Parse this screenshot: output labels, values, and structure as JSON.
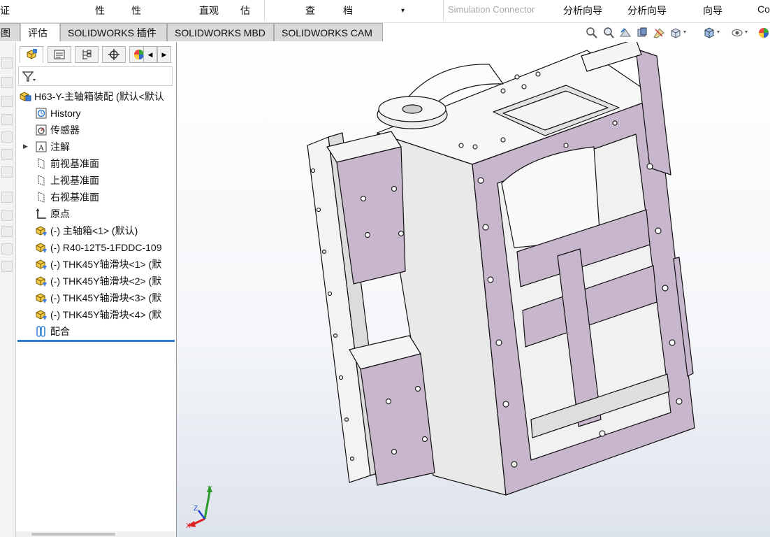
{
  "ribbon": {
    "commands": [
      "证",
      "性",
      "性",
      "直观",
      "估",
      "查",
      "档",
      "▾",
      "Simulation Connector",
      "分析向导",
      "分析向导",
      "向导",
      "Co"
    ]
  },
  "tabs": [
    {
      "label": "图"
    },
    {
      "label": "评估"
    },
    {
      "label": "SOLIDWORKS 插件"
    },
    {
      "label": "SOLIDWORKS MBD"
    },
    {
      "label": "SOLIDWORKS CAM"
    }
  ],
  "feature_tree": {
    "root": "H63-Y-主轴箱装配  (默认<默认",
    "items": [
      {
        "label": "History",
        "icon": "history-icon"
      },
      {
        "label": "传感器",
        "icon": "sensor-icon"
      },
      {
        "label": "注解",
        "icon": "annotation-icon"
      },
      {
        "label": "前视基准面",
        "icon": "plane-icon"
      },
      {
        "label": "上视基准面",
        "icon": "plane-icon"
      },
      {
        "label": "右视基准面",
        "icon": "plane-icon"
      },
      {
        "label": "原点",
        "icon": "origin-icon"
      },
      {
        "label": "(-) 主轴箱<1> (默认)",
        "icon": "part-icon"
      },
      {
        "label": "(-) R40-12T5-1FDDC-109",
        "icon": "part-icon"
      },
      {
        "label": "(-) THK45Y轴滑块<1> (默",
        "icon": "part-icon"
      },
      {
        "label": "(-) THK45Y轴滑块<2> (默",
        "icon": "part-icon"
      },
      {
        "label": "(-) THK45Y轴滑块<3> (默",
        "icon": "part-icon"
      },
      {
        "label": "(-) THK45Y轴滑块<4> (默",
        "icon": "part-icon"
      },
      {
        "label": "配合",
        "icon": "mate-icon"
      }
    ]
  },
  "triad": {
    "x": "X",
    "y": "Y",
    "z": "Z"
  },
  "colors": {
    "accent": "#2f7dd3",
    "face": "#c8b6cc",
    "body": "#ececec"
  }
}
